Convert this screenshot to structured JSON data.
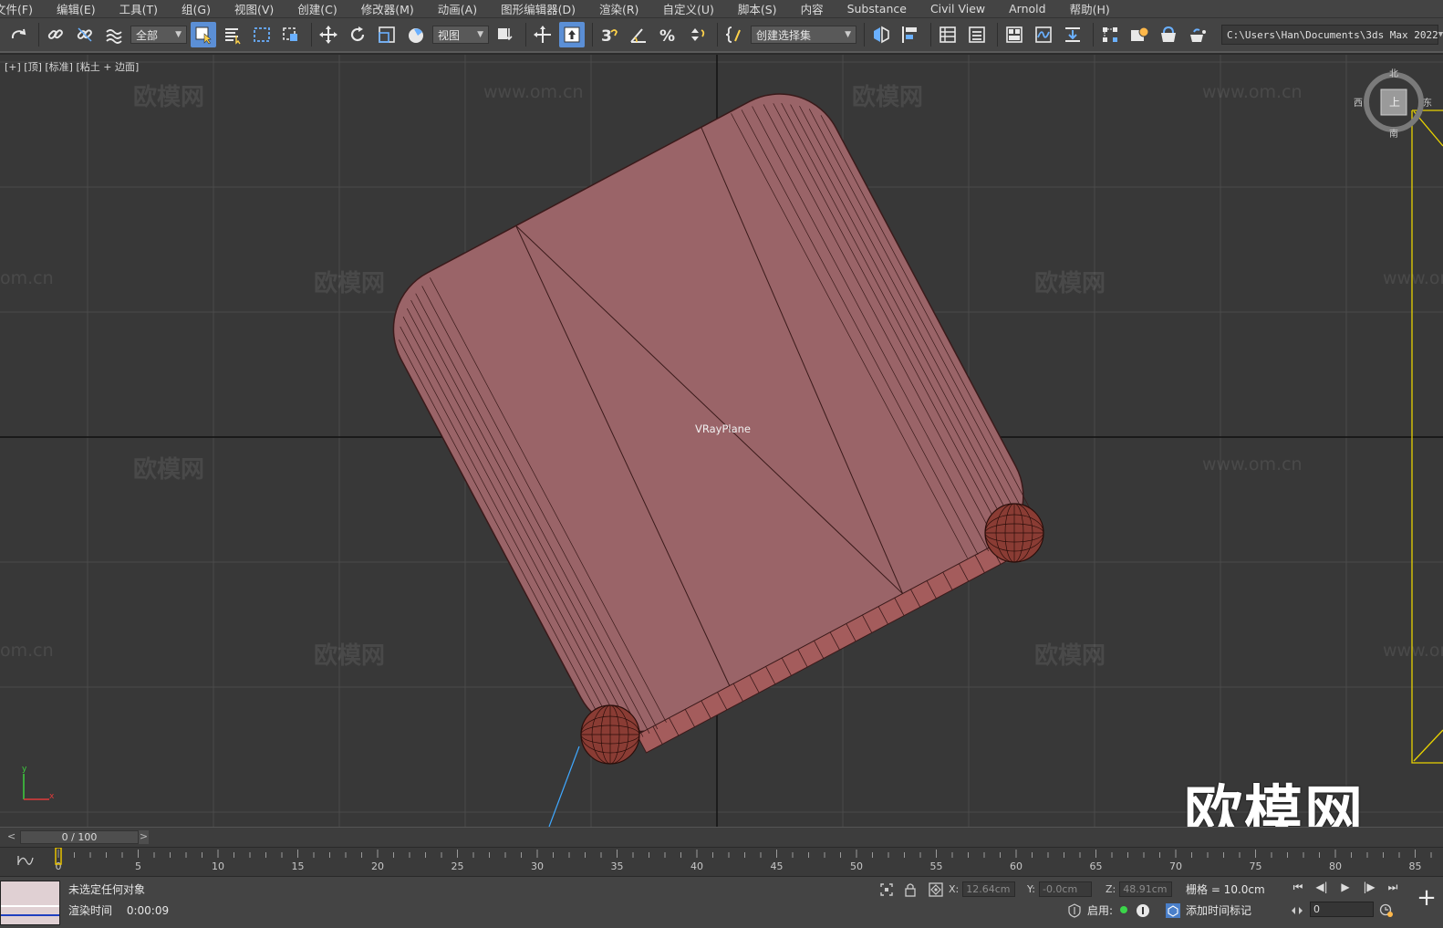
{
  "menu": [
    "文件(F)",
    "编辑(E)",
    "工具(T)",
    "组(G)",
    "视图(V)",
    "创建(C)",
    "修改器(M)",
    "动画(A)",
    "图形编辑器(D)",
    "渲染(R)",
    "自定义(U)",
    "脚本(S)",
    "内容",
    "Substance",
    "Civil View",
    "Arnold",
    "帮助(H)"
  ],
  "toolbar": {
    "filter_dropdown": "全部",
    "refcoord_dropdown": "视图",
    "selection_set_dropdown": "创建选择集",
    "project_path": "C:\\Users\\Han\\Documents\\3ds Max 2022"
  },
  "viewport": {
    "label": "[+] [顶] [标准] [粘土 + 边面]",
    "object_label": "VRayPlane",
    "watermark_brand": "欧模网",
    "watermark_url": "www.om.cn",
    "watermark_url_partial": "om.cn",
    "big_watermark": "欧模网",
    "viewcube_n": "北",
    "viewcube_w": "西",
    "viewcube_e": "东",
    "viewcube_s": "南",
    "viewcube_face": "上",
    "axis_y": "y",
    "axis_x": "x"
  },
  "timeslider": {
    "value": "0 / 100",
    "prev": "<",
    "next": ">"
  },
  "trackbar": {
    "ticks": [
      "0",
      "5",
      "10",
      "15",
      "20",
      "25",
      "30",
      "35",
      "40",
      "45",
      "50",
      "55",
      "60",
      "65",
      "70",
      "75",
      "80",
      "85"
    ]
  },
  "status": {
    "selection": "未选定任何对象",
    "render_time_label": "渲染时间",
    "render_time_value": "0:00:09",
    "x_label": "X:",
    "x_value": "12.64cm",
    "y_label": "Y:",
    "y_value": "-0.0cm",
    "z_label": "Z:",
    "z_value": "48.91cm",
    "grid": "栅格 = 10.0cm",
    "enable": "启用:",
    "add_time_tag": "添加时间标记",
    "frame_value": "0"
  },
  "colors": {
    "object": "#9a6468",
    "object_wire": "#3a1a1a",
    "viewport_bg": "#383838",
    "accent": "#5b8fd6"
  }
}
